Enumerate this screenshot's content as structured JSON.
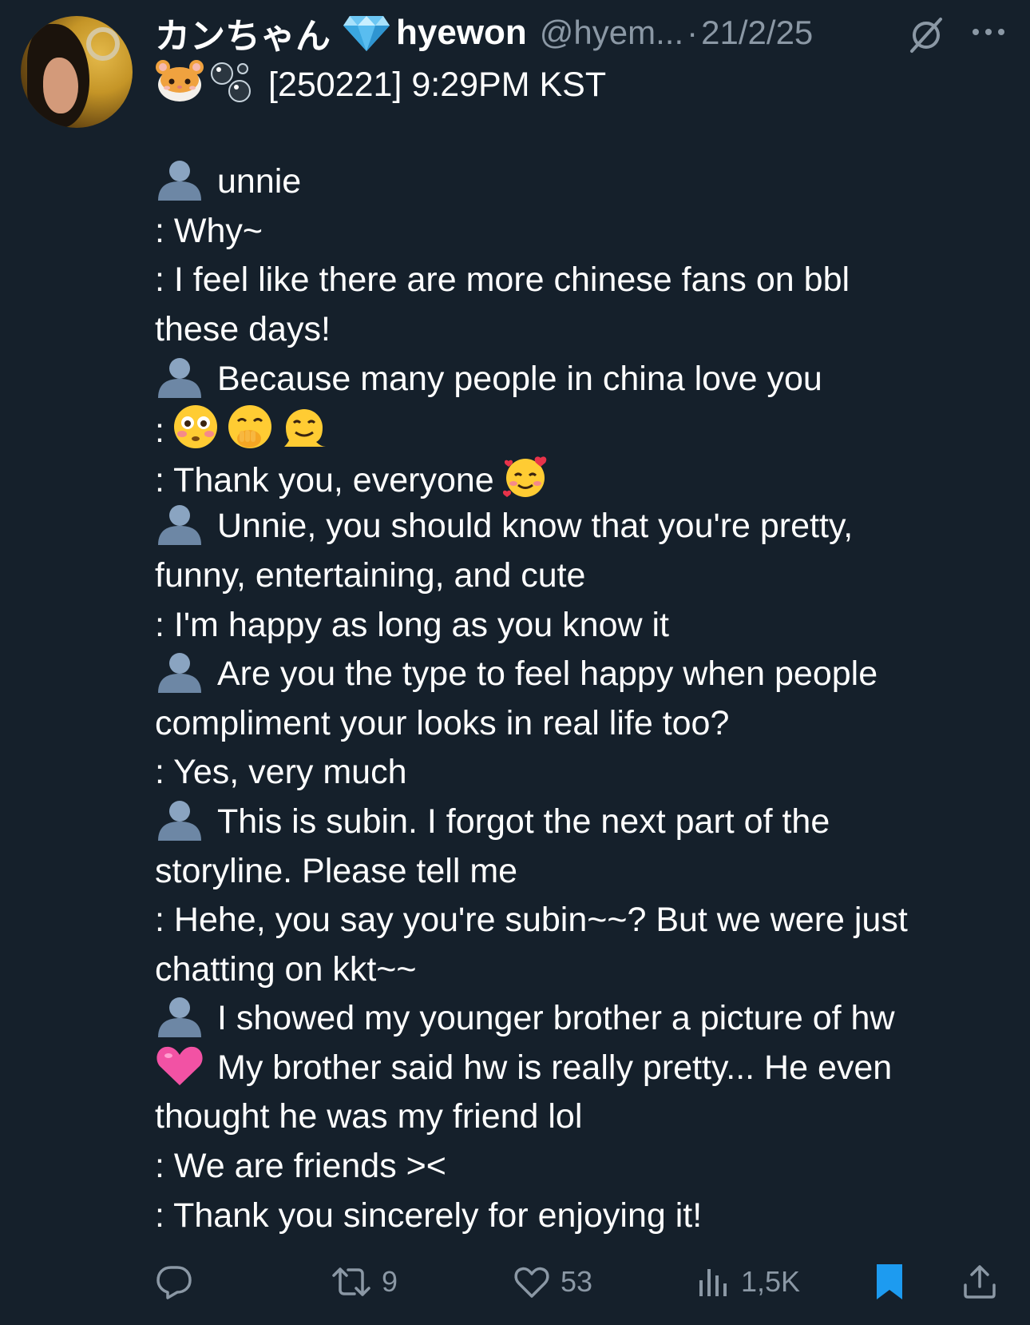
{
  "author": {
    "display_name": "カンちゃん",
    "display_name_2": "hyewon",
    "handle": "@hyem...",
    "separator": "·",
    "date": "21/2/25"
  },
  "tweet": {
    "lines": [
      {
        "kind": "header",
        "text": "[250221] 9:29PM KST"
      },
      {
        "kind": "blank",
        "text": ""
      },
      {
        "kind": "q",
        "text": "unnie"
      },
      {
        "kind": "a",
        "text": ": Why~"
      },
      {
        "kind": "a",
        "text": ": I feel like there are more chinese fans on bbl"
      },
      {
        "kind": "plain",
        "text": "these days!"
      },
      {
        "kind": "q",
        "text": "Because many people in china love you"
      },
      {
        "kind": "emoji",
        "text": ":"
      },
      {
        "kind": "thanks",
        "text": ": Thank you, everyone"
      },
      {
        "kind": "q",
        "text": "Unnie, you should know that you're pretty,"
      },
      {
        "kind": "plain",
        "text": "funny, entertaining, and cute"
      },
      {
        "kind": "a",
        "text": ": I'm happy as long as you know it"
      },
      {
        "kind": "q",
        "text": "Are you the type to feel happy when people"
      },
      {
        "kind": "plain",
        "text": "compliment your looks in real life too?"
      },
      {
        "kind": "a",
        "text": ": Yes, very much"
      },
      {
        "kind": "q",
        "text": "This is subin. I forgot the next part of the"
      },
      {
        "kind": "plain",
        "text": "storyline. Please tell me"
      },
      {
        "kind": "a",
        "text": ": Hehe, you say you're subin~~? But we were just"
      },
      {
        "kind": "plain",
        "text": "chatting on kkt~~"
      },
      {
        "kind": "q",
        "text": "I showed my younger brother a picture of hw"
      },
      {
        "kind": "heart",
        "text": "My brother said hw is really pretty... He even"
      },
      {
        "kind": "plain",
        "text": "thought he was my friend lol"
      },
      {
        "kind": "a",
        "text": ": We are friends ><"
      },
      {
        "kind": "a",
        "text": ": Thank you sincerely for enjoying it!"
      }
    ],
    "icons": {
      "header": [
        "hamster-face-icon",
        "bubbles-icon"
      ],
      "question": "bust-in-silhouette-icon",
      "emoji_reactions": [
        "flushed-face-icon",
        "face-with-hand-over-mouth-icon",
        "melting-face-icon"
      ],
      "thanks": "smiling-face-with-hearts-icon",
      "heart": "pink-heart-icon"
    }
  },
  "actions": {
    "reply_count": "",
    "retweet_count": "9",
    "like_count": "53",
    "views_count": "1,5K",
    "bookmarked": true
  },
  "colors": {
    "background": "#15202b",
    "text": "#ffffff",
    "secondary": "#8b98a5",
    "bookmark": "#1d9bf0",
    "gem": "#5ec3f2"
  }
}
